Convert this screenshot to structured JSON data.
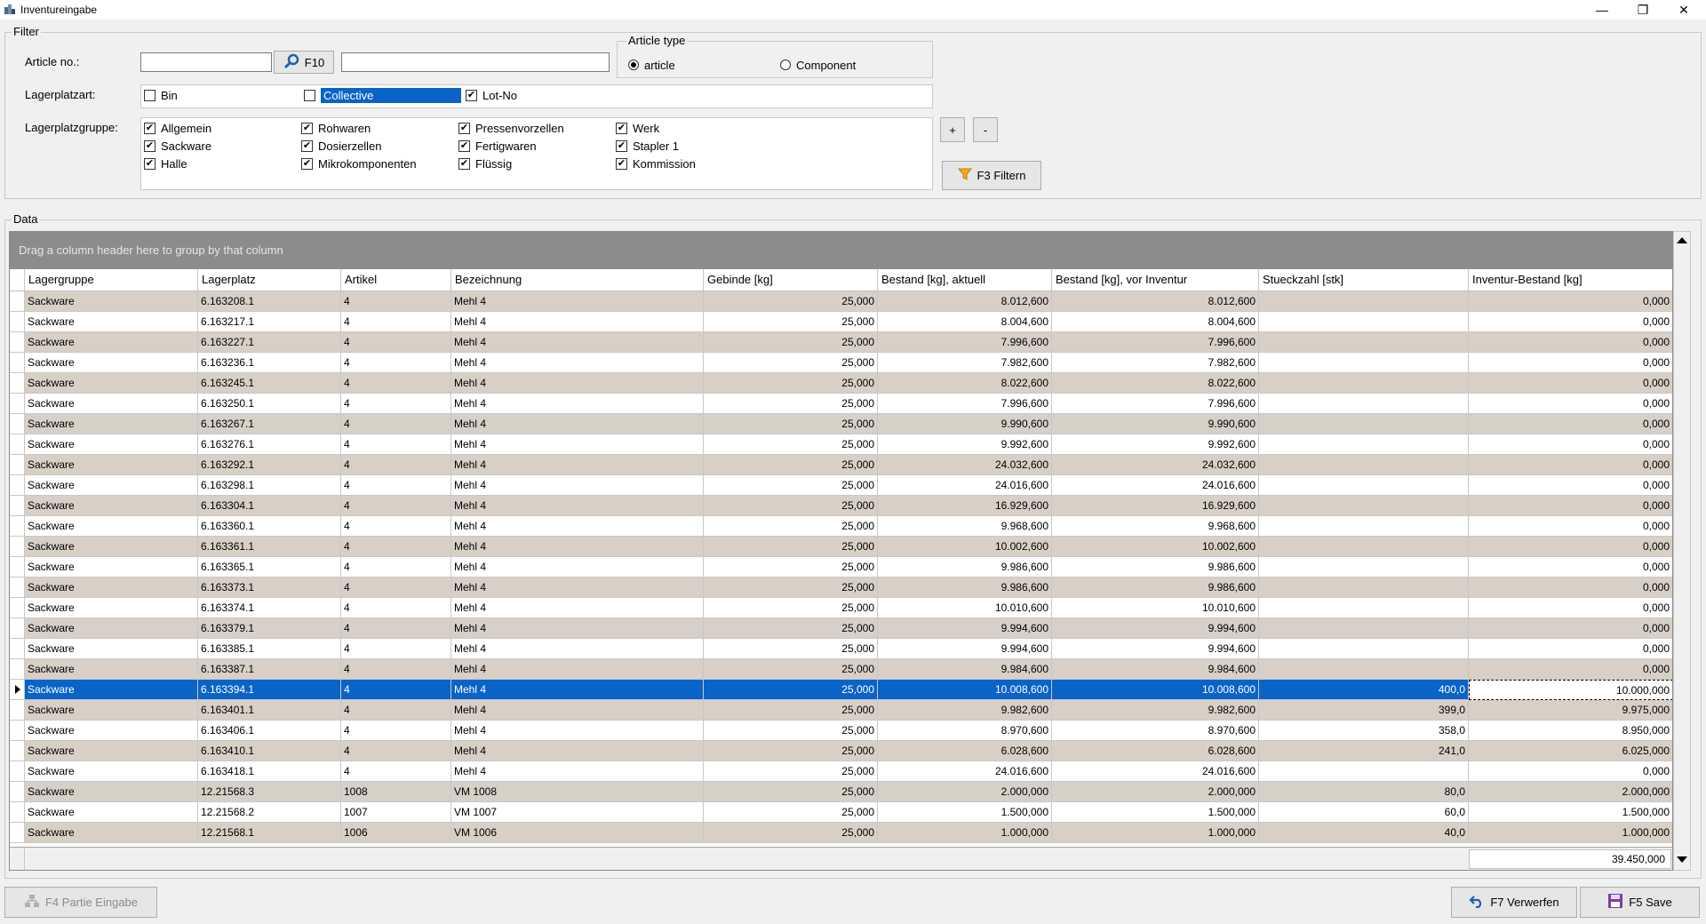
{
  "window": {
    "title": "Inventureingabe",
    "minimize": "—",
    "restore": "❐",
    "close": "✕"
  },
  "filter": {
    "legend": "Filter",
    "article_no_label": "Article no.:",
    "article_no_value": "",
    "search_button": "F10",
    "article_desc_value": "",
    "article_type": {
      "legend": "Article type",
      "options": [
        "article",
        "Component"
      ],
      "selected": "article"
    },
    "lagerplatzart_label": "Lagerplatzart:",
    "lagerplatzart": [
      {
        "label": "Bin",
        "checked": false
      },
      {
        "label": "Collective",
        "checked": false
      },
      {
        "label": "Lot-No",
        "checked": true
      }
    ],
    "lagerplatzgruppe_label": "Lagerplatzgruppe:",
    "lagerplatzgruppe": [
      {
        "label": "Allgemein",
        "checked": true
      },
      {
        "label": "Sackware",
        "checked": true
      },
      {
        "label": "Halle",
        "checked": true
      },
      {
        "label": "Rohwaren",
        "checked": true
      },
      {
        "label": "Dosierzellen",
        "checked": true
      },
      {
        "label": "Mikrokomponenten",
        "checked": true
      },
      {
        "label": "Pressenvorzellen",
        "checked": true
      },
      {
        "label": "Fertigwaren",
        "checked": true
      },
      {
        "label": "Flüssig",
        "checked": true
      },
      {
        "label": "Werk",
        "checked": true
      },
      {
        "label": "Stapler 1",
        "checked": true
      },
      {
        "label": "Kommission",
        "checked": true
      }
    ],
    "plus_button": "+",
    "minus_button": "-",
    "filter_button": "F3 Filtern"
  },
  "data_section": {
    "legend": "Data",
    "group_hint": "Drag a column header here to group by that column",
    "columns": [
      "Lagergruppe",
      "Lagerplatz",
      "Artikel",
      "Bezeichnung",
      "Gebinde [kg]",
      "Bestand [kg], aktuell",
      "Bestand [kg], vor Inventur",
      "Stueckzahl [stk]",
      "Inventur-Bestand [kg]"
    ],
    "rows": [
      [
        "Sackware",
        "6.163208.1",
        "4",
        "Mehl 4",
        "25,000",
        "8.012,600",
        "8.012,600",
        "",
        "0,000"
      ],
      [
        "Sackware",
        "6.163217.1",
        "4",
        "Mehl 4",
        "25,000",
        "8.004,600",
        "8.004,600",
        "",
        "0,000"
      ],
      [
        "Sackware",
        "6.163227.1",
        "4",
        "Mehl 4",
        "25,000",
        "7.996,600",
        "7.996,600",
        "",
        "0,000"
      ],
      [
        "Sackware",
        "6.163236.1",
        "4",
        "Mehl 4",
        "25,000",
        "7.982,600",
        "7.982,600",
        "",
        "0,000"
      ],
      [
        "Sackware",
        "6.163245.1",
        "4",
        "Mehl 4",
        "25,000",
        "8.022,600",
        "8.022,600",
        "",
        "0,000"
      ],
      [
        "Sackware",
        "6.163250.1",
        "4",
        "Mehl 4",
        "25,000",
        "7.996,600",
        "7.996,600",
        "",
        "0,000"
      ],
      [
        "Sackware",
        "6.163267.1",
        "4",
        "Mehl 4",
        "25,000",
        "9.990,600",
        "9.990,600",
        "",
        "0,000"
      ],
      [
        "Sackware",
        "6.163276.1",
        "4",
        "Mehl 4",
        "25,000",
        "9.992,600",
        "9.992,600",
        "",
        "0,000"
      ],
      [
        "Sackware",
        "6.163292.1",
        "4",
        "Mehl 4",
        "25,000",
        "24.032,600",
        "24.032,600",
        "",
        "0,000"
      ],
      [
        "Sackware",
        "6.163298.1",
        "4",
        "Mehl 4",
        "25,000",
        "24.016,600",
        "24.016,600",
        "",
        "0,000"
      ],
      [
        "Sackware",
        "6.163304.1",
        "4",
        "Mehl 4",
        "25,000",
        "16.929,600",
        "16.929,600",
        "",
        "0,000"
      ],
      [
        "Sackware",
        "6.163360.1",
        "4",
        "Mehl 4",
        "25,000",
        "9.968,600",
        "9.968,600",
        "",
        "0,000"
      ],
      [
        "Sackware",
        "6.163361.1",
        "4",
        "Mehl 4",
        "25,000",
        "10.002,600",
        "10.002,600",
        "",
        "0,000"
      ],
      [
        "Sackware",
        "6.163365.1",
        "4",
        "Mehl 4",
        "25,000",
        "9.986,600",
        "9.986,600",
        "",
        "0,000"
      ],
      [
        "Sackware",
        "6.163373.1",
        "4",
        "Mehl 4",
        "25,000",
        "9.986,600",
        "9.986,600",
        "",
        "0,000"
      ],
      [
        "Sackware",
        "6.163374.1",
        "4",
        "Mehl 4",
        "25,000",
        "10.010,600",
        "10.010,600",
        "",
        "0,000"
      ],
      [
        "Sackware",
        "6.163379.1",
        "4",
        "Mehl 4",
        "25,000",
        "9.994,600",
        "9.994,600",
        "",
        "0,000"
      ],
      [
        "Sackware",
        "6.163385.1",
        "4",
        "Mehl 4",
        "25,000",
        "9.994,600",
        "9.994,600",
        "",
        "0,000"
      ],
      [
        "Sackware",
        "6.163387.1",
        "4",
        "Mehl 4",
        "25,000",
        "9.984,600",
        "9.984,600",
        "",
        "0,000"
      ],
      [
        "Sackware",
        "6.163394.1",
        "4",
        "Mehl 4",
        "25,000",
        "10.008,600",
        "10.008,600",
        "400,0",
        "10.000,000"
      ],
      [
        "Sackware",
        "6.163401.1",
        "4",
        "Mehl 4",
        "25,000",
        "9.982,600",
        "9.982,600",
        "399,0",
        "9.975,000"
      ],
      [
        "Sackware",
        "6.163406.1",
        "4",
        "Mehl 4",
        "25,000",
        "8.970,600",
        "8.970,600",
        "358,0",
        "8.950,000"
      ],
      [
        "Sackware",
        "6.163410.1",
        "4",
        "Mehl 4",
        "25,000",
        "6.028,600",
        "6.028,600",
        "241,0",
        "6.025,000"
      ],
      [
        "Sackware",
        "6.163418.1",
        "4",
        "Mehl 4",
        "25,000",
        "24.016,600",
        "24.016,600",
        "",
        "0,000"
      ],
      [
        "Sackware",
        "12.21568.3",
        "1008",
        "VM 1008",
        "25,000",
        "2.000,000",
        "2.000,000",
        "80,0",
        "2.000,000"
      ],
      [
        "Sackware",
        "12.21568.2",
        "1007",
        "VM 1007",
        "25,000",
        "1.500,000",
        "1.500,000",
        "60,0",
        "1.500,000"
      ],
      [
        "Sackware",
        "12.21568.1",
        "1006",
        "VM 1006",
        "25,000",
        "1.000,000",
        "1.000,000",
        "40,0",
        "1.000,000"
      ]
    ],
    "selected_row": 19,
    "total": "39.450,000"
  },
  "bottom_bar": {
    "partie_button": "F4 Partie Eingabe",
    "verwerfen_button": "F7 Verwerfen",
    "save_button": "F5 Save"
  },
  "colors": {
    "selection": "#0a64c8",
    "row_alt": "#d8cfc6",
    "group_band": "#8c8c8c"
  }
}
